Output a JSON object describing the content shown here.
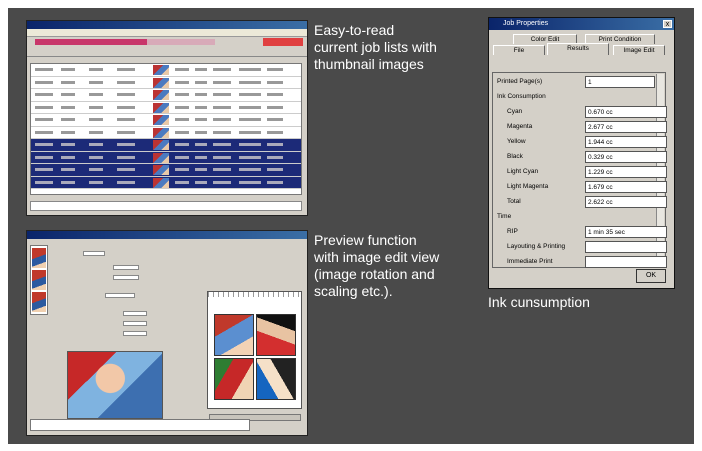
{
  "captions": {
    "job_list": "Easy-to-read\ncurrent job lists with\nthumbnail images",
    "preview": "Preview function\nwith image edit view\n(image rotation and\nscaling etc.).",
    "ink": "Ink cunsumption"
  },
  "job_list_shot": {
    "progress_fraction": 0.62,
    "selected_rows": [
      6,
      7,
      8,
      9
    ]
  },
  "dialog": {
    "title": "Job Properties",
    "close_glyph": "x",
    "tabs_back": [
      "Color Edit",
      "Print Condition"
    ],
    "tabs_front": [
      "File",
      "Results",
      "Image Edit"
    ],
    "active_tab": "Results",
    "rows": [
      {
        "label": "Printed Page(s)",
        "value": "1",
        "section": true,
        "short": true
      },
      {
        "label": "Ink Consumption",
        "value": null,
        "section": true
      },
      {
        "label": "Cyan",
        "value": "0.670 cc"
      },
      {
        "label": "Magenta",
        "value": "2.677 cc"
      },
      {
        "label": "Yellow",
        "value": "1.944 cc"
      },
      {
        "label": "Black",
        "value": "0.329 cc"
      },
      {
        "label": "Light Cyan",
        "value": "1.229 cc"
      },
      {
        "label": "Light Magenta",
        "value": "1.679 cc"
      },
      {
        "label": "Total",
        "value": "2.622 cc"
      },
      {
        "label": "Time",
        "value": null,
        "section": true
      },
      {
        "label": "RIP",
        "value": "1 min 35 sec"
      },
      {
        "label": "Layouting & Printing",
        "value": ""
      },
      {
        "label": "Immediate Print",
        "value": ""
      }
    ],
    "ok_label": "OK"
  },
  "colors": {
    "background": "#4a4a4a",
    "title_bar": "#0a246a",
    "selection": "#1c2a78",
    "progress": "#c8366a"
  }
}
